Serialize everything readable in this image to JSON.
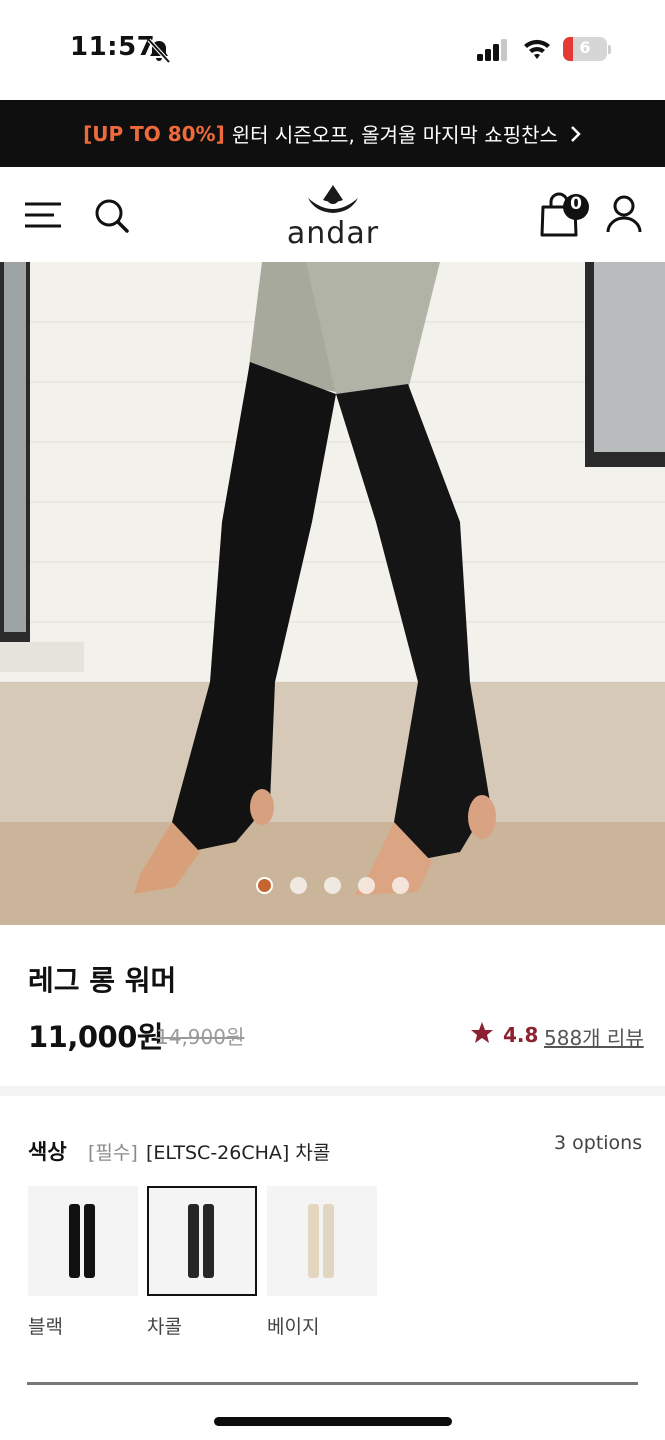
{
  "status_bar": {
    "time": "11:57",
    "battery_level": "6",
    "icons": [
      "bell-slash-icon",
      "signal-icon",
      "wifi-icon",
      "battery-icon"
    ]
  },
  "promo": {
    "highlight": "[UP TO 80%]",
    "text": "윈터 시즌오프, 올겨울 마지막 쇼핑찬스",
    "highlight_color": "#ef6a3a",
    "background_color": "#0f0f0f"
  },
  "header": {
    "logo_text": "andar",
    "cart_count": "0"
  },
  "hero": {
    "slide_count": 5,
    "active_slide": 1
  },
  "product": {
    "name": "레그 롱 워머",
    "price": "11,000원",
    "original_price": "14,900원",
    "rating": "4.8",
    "reviews": "588개 리뷰",
    "rating_color": "#8b2232"
  },
  "options": {
    "label": "색상",
    "required": "[필수]",
    "selected_value": "[ELTSC-26CHA] 차콜",
    "count": "3 options",
    "swatches": [
      {
        "label": "블랙",
        "color": "#111111",
        "selected": false
      },
      {
        "label": "차콜",
        "color": "#262626",
        "selected": true
      },
      {
        "label": "베이지",
        "color": "#e2d6c0",
        "selected": false
      }
    ]
  }
}
